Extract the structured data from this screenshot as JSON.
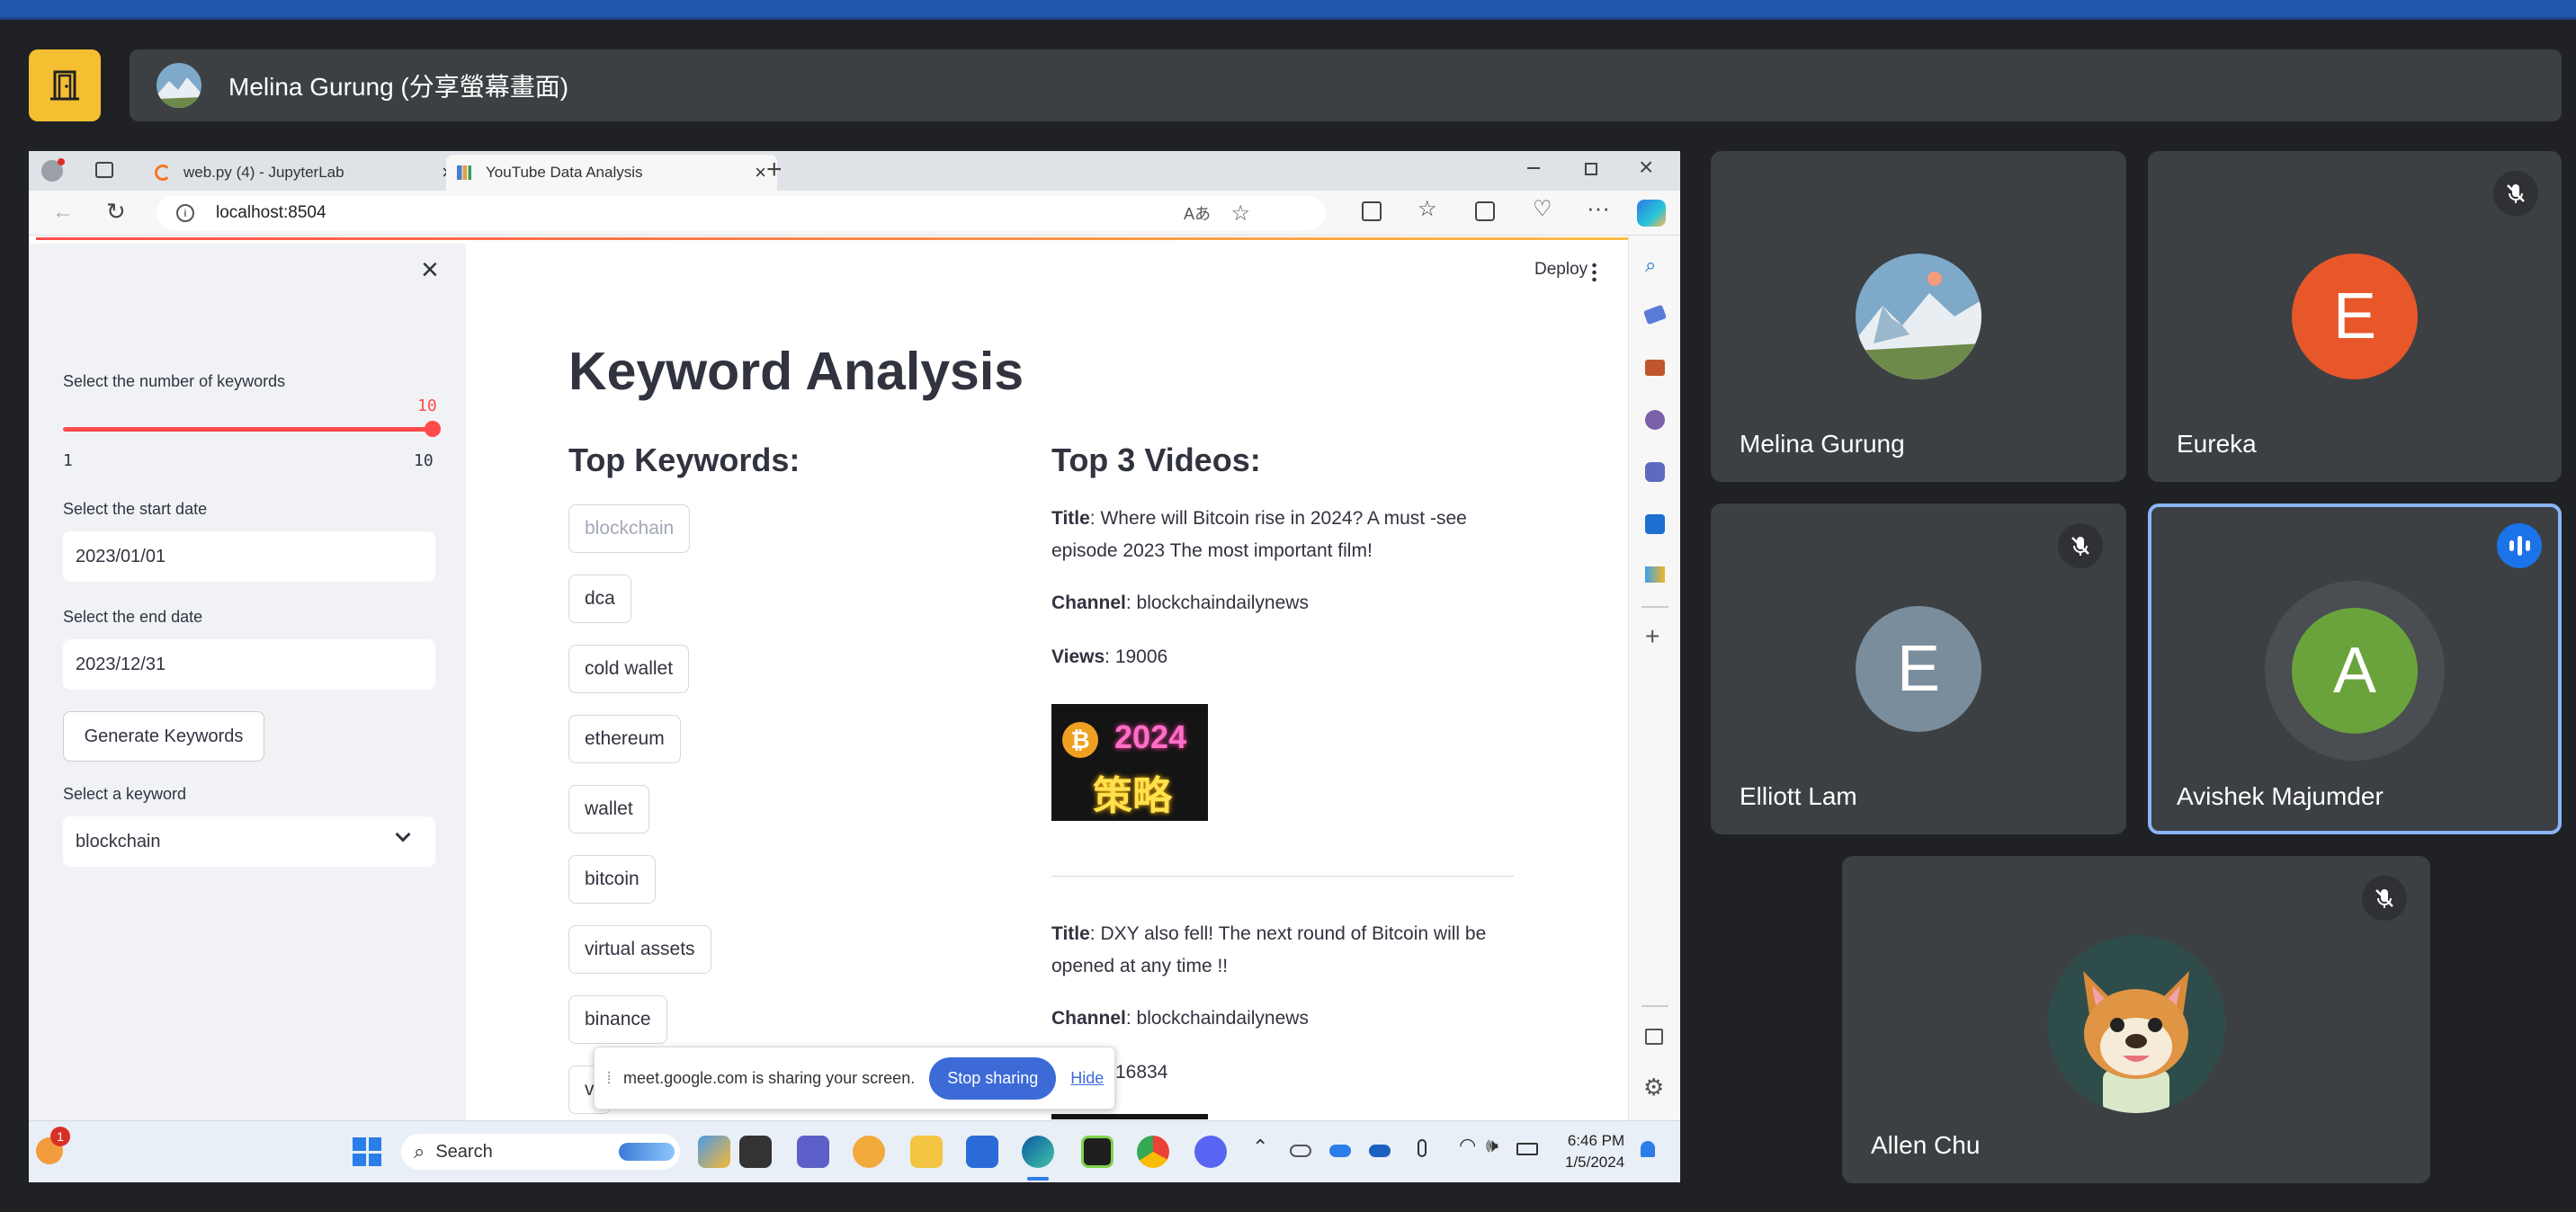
{
  "meeting": {
    "presenter_label": "Melina Gurung (分享螢幕畫面)"
  },
  "browser": {
    "tabs": [
      {
        "label": "web.py (4) - JupyterLab"
      },
      {
        "label": "YouTube Data Analysis"
      }
    ],
    "url": "localhost:8504"
  },
  "app": {
    "deploy_label": "Deploy",
    "sidebar": {
      "num_keywords_label": "Select the number of keywords",
      "slider_value": "10",
      "slider_min": "1",
      "slider_max": "10",
      "slider_fraction": 1.0,
      "start_date_label": "Select the start date",
      "start_date": "2023/01/01",
      "end_date_label": "Select the end date",
      "end_date": "2023/12/31",
      "generate_button": "Generate Keywords",
      "keyword_select_label": "Select a keyword",
      "keyword_selected": "blockchain"
    },
    "title": "Keyword Analysis",
    "top_keywords_heading": "Top Keywords:",
    "keywords": [
      "blockchain",
      "dca",
      "cold wallet",
      "ethereum",
      "wallet",
      "bitcoin",
      "virtual assets",
      "binance",
      "v"
    ],
    "top_videos_heading": "Top 3 Videos:",
    "videos": [
      {
        "title_label": "Title",
        "title": ": Where will Bitcoin rise in 2024? A must -see episode 2023 The most important film!",
        "channel_label": "Channel",
        "channel": ": blockchaindailynews",
        "views_label": "Views",
        "views": ": 19006",
        "thumb_year": "2024",
        "thumb_text": "策略"
      },
      {
        "title_label": "Title",
        "title": ": DXY also fell! The next round of Bitcoin will be opened at any time !!",
        "channel_label": "Channel",
        "channel": ": blockchaindailynews",
        "views_partial": "16834"
      }
    ]
  },
  "share_banner": {
    "text": "meet.google.com is sharing your screen.",
    "stop_label": "Stop sharing",
    "hide_label": "Hide"
  },
  "taskbar": {
    "search_label": "Search",
    "time": "6:46 PM",
    "date": "1/5/2024",
    "badge": "1"
  },
  "participants": [
    {
      "name": "Melina Gurung"
    },
    {
      "name": "Eureka",
      "initial": "E",
      "color": "#e8572a"
    },
    {
      "name": "Elliott Lam",
      "initial": "E",
      "color": "#7a8d9c"
    },
    {
      "name": "Avishek Majumder",
      "initial": "A",
      "color": "#6aa33c"
    },
    {
      "name": "Allen Chu"
    }
  ],
  "colors": {
    "accent_blue": "#8ab4f8",
    "exit_yellow": "#f4bf31",
    "slider_red": "#ff4b4b",
    "stop_blue": "#3c6bd8"
  }
}
